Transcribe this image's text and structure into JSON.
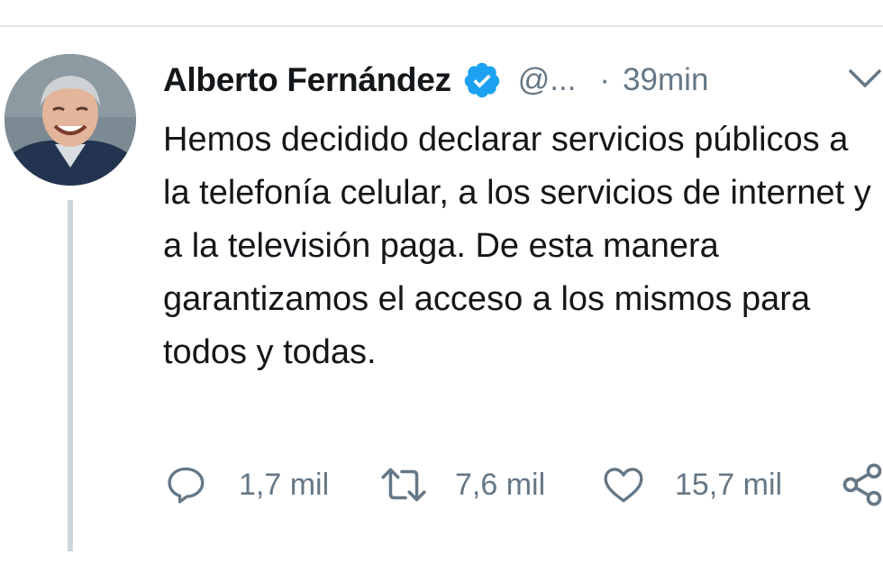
{
  "tweet": {
    "author": {
      "name": "Alberto Fernández",
      "handle": "@...",
      "verified": true,
      "verified_icon": "verified-badge-icon"
    },
    "separator": "·",
    "time": "39min",
    "text": "Hemos decidido declarar servicios públicos a la telefonía celular, a los servicios de internet y a la televisión paga. De esta manera garantizamos el acceso a los mismos para todos y todas.",
    "actions": {
      "reply": {
        "icon": "reply-icon",
        "count": "1,7 mil"
      },
      "retweet": {
        "icon": "retweet-icon",
        "count": "7,6 mil"
      },
      "like": {
        "icon": "heart-icon",
        "count": "15,7 mil"
      },
      "share": {
        "icon": "share-icon"
      }
    }
  },
  "colors": {
    "text_primary": "#14171a",
    "text_secondary": "#657786",
    "verified_blue": "#1da1f2",
    "thread_line": "#ccd6dd",
    "divider": "#e1e8ed"
  }
}
